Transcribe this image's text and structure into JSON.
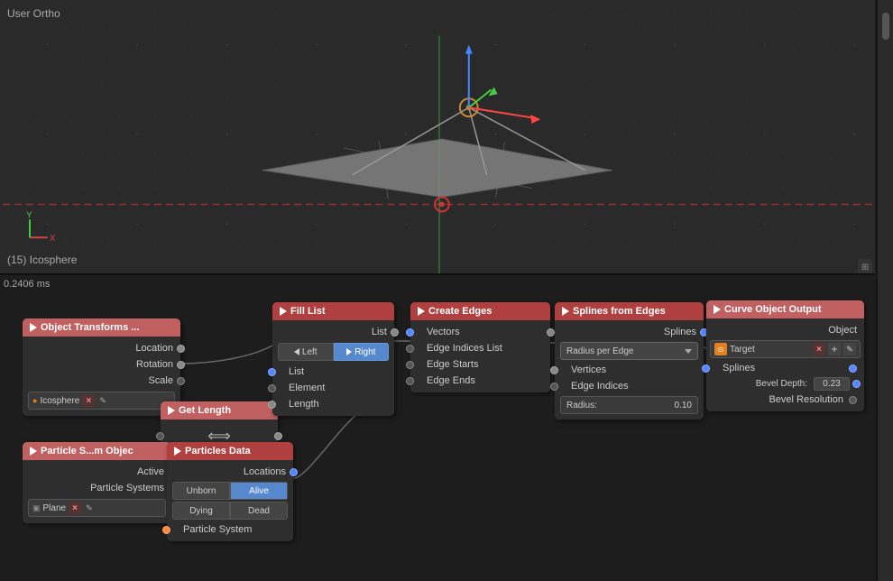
{
  "viewport": {
    "label": "User Ortho",
    "object_label": "(15) Icosphere",
    "timing": "0.2406 ms"
  },
  "nodes": {
    "object_transforms": {
      "title": "Object Transforms ...",
      "rows": [
        "Location",
        "Rotation",
        "Scale"
      ],
      "pill": "Icosphere"
    },
    "fill_list": {
      "title": "Fill List",
      "output_label": "List",
      "toggle_left": "Left",
      "toggle_right": "Right",
      "rows": [
        "List",
        "Element",
        "Length"
      ]
    },
    "create_edges": {
      "title": "Create Edges",
      "rows": [
        "Vectors",
        "Edge Indices List",
        "Edge Starts",
        "Edge Ends"
      ]
    },
    "splines_from_edges": {
      "title": "Splines from Edges",
      "output_label": "Splines",
      "dropdown": "Radius per Edge",
      "rows": [
        "Vertices",
        "Edge Indices"
      ],
      "radius_label": "Radius:",
      "radius_value": "0.10"
    },
    "curve_object_output": {
      "title": "Curve Object Output",
      "output_label": "Object",
      "target_label": "Target",
      "splines_label": "Splines",
      "bevel_depth_label": "Bevel Depth:",
      "bevel_depth_value": "0.23",
      "bevel_resolution_label": "Bevel Resolution"
    },
    "particle_system_object": {
      "title": "Particle S...m Objec",
      "rows": [
        "Active",
        "Particle Systems"
      ],
      "pill": "Plane"
    },
    "particles_data": {
      "title": "Particles Data",
      "locations_label": "Locations",
      "btn_unborn": "Unborn",
      "btn_alive": "Alive",
      "btn_dying": "Dying",
      "btn_dead": "Dead",
      "particle_system_label": "Particle System"
    },
    "get_length": {
      "title": "Get Length"
    }
  },
  "icons": {
    "triangle": "▶",
    "arrow_left": "◀",
    "arrow_right": "▶",
    "close": "×",
    "add": "+",
    "eye": "👁",
    "sphere_icon": "●",
    "plane_icon": "▣"
  }
}
